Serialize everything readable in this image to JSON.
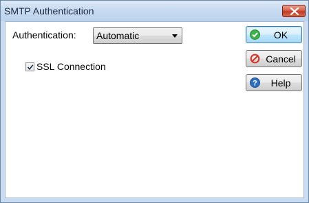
{
  "window": {
    "title": "SMTP Authentication"
  },
  "form": {
    "authentication_label": "Authentication:",
    "authentication_value": "Automatic",
    "ssl_label": "SSL Connection",
    "ssl_checked": true
  },
  "buttons": {
    "ok": "OK",
    "cancel": "Cancel",
    "help": "Help"
  },
  "colors": {
    "ok_icon": "#3fb14a",
    "cancel_icon": "#d33a2c",
    "help_icon": "#2f6fc0"
  }
}
